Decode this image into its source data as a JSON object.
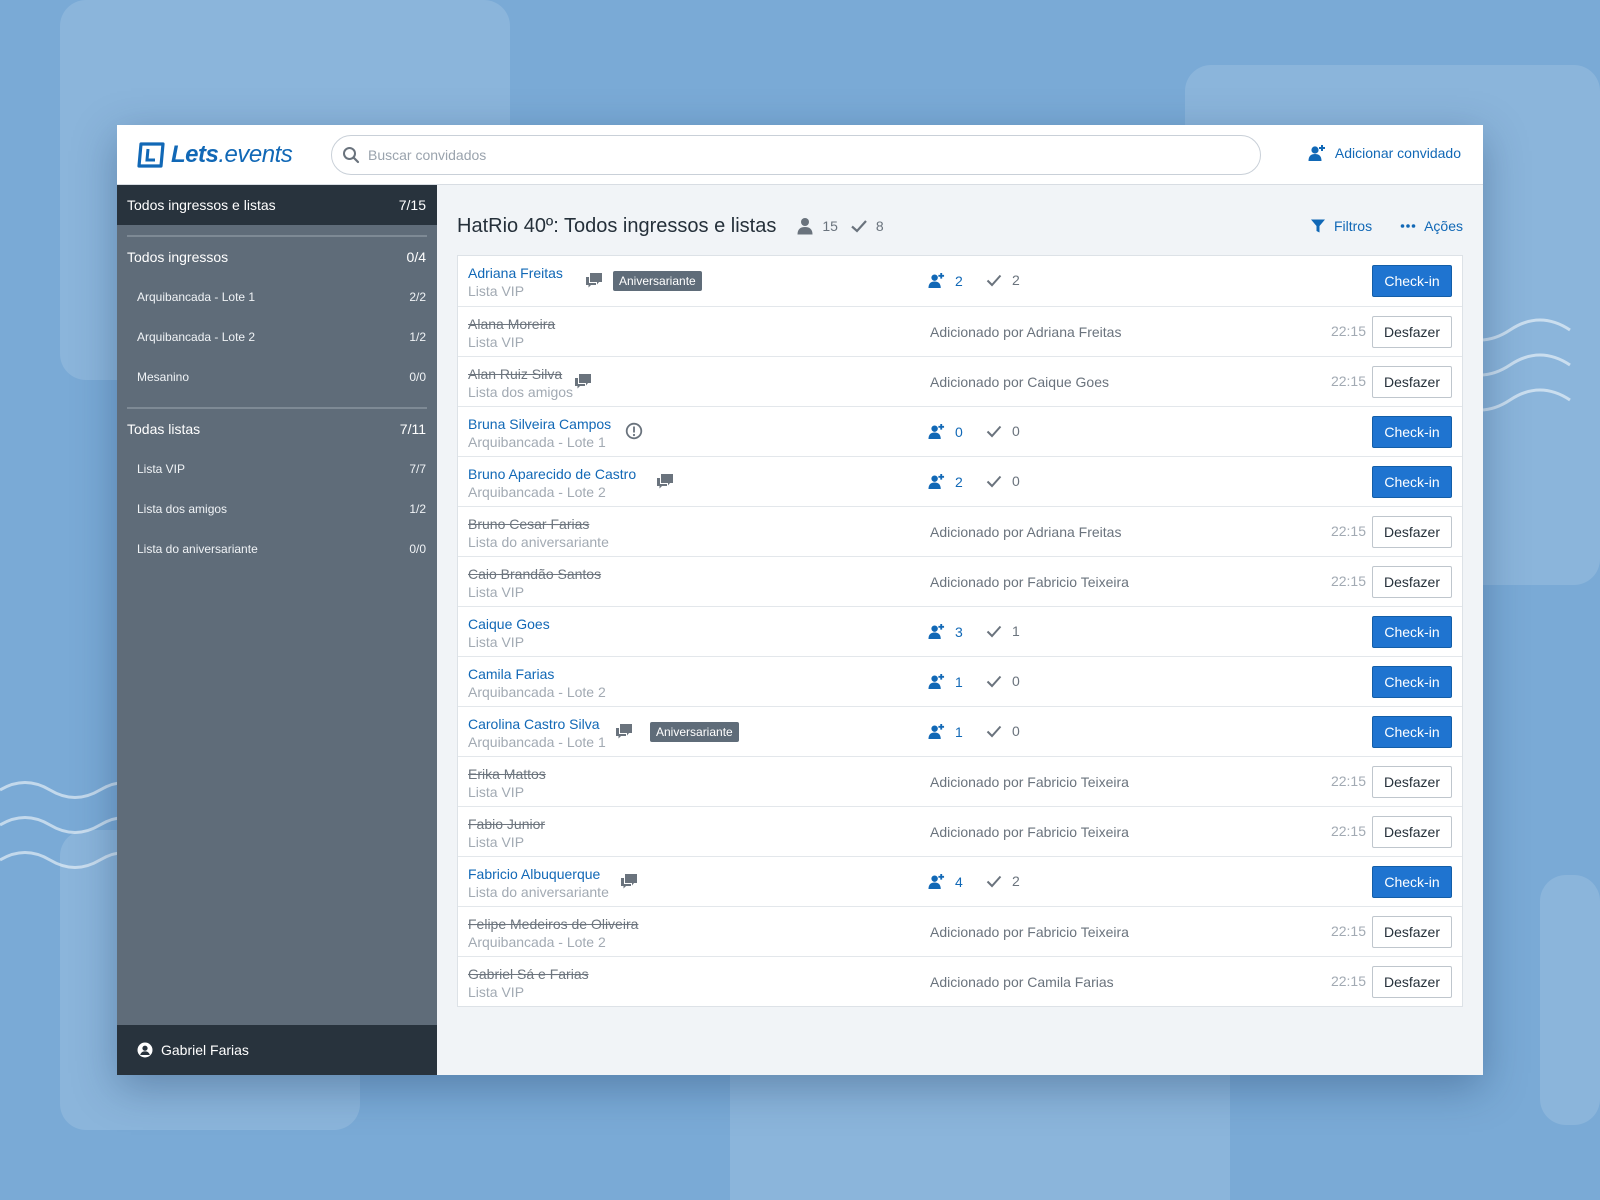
{
  "brand": {
    "name_bold": "Lets",
    "name_light": ".events"
  },
  "search": {
    "placeholder": "Buscar convidados",
    "value": ""
  },
  "header": {
    "add_guest_label": "Adicionar convidado"
  },
  "sidebar": {
    "active": {
      "label": "Todos ingressos e listas",
      "count": "7/15"
    },
    "groups": [
      {
        "label": "Todos ingressos",
        "count": "0/4",
        "items": [
          {
            "label": "Arquibancada - Lote 1",
            "count": "2/2"
          },
          {
            "label": "Arquibancada - Lote 2",
            "count": "1/2"
          },
          {
            "label": "Mesanino",
            "count": "0/0"
          }
        ]
      },
      {
        "label": "Todas listas",
        "count": "7/11",
        "items": [
          {
            "label": "Lista VIP",
            "count": "7/7"
          },
          {
            "label": "Lista dos amigos",
            "count": "1/2"
          },
          {
            "label": "Lista do aniversariante",
            "count": "0/0"
          }
        ]
      }
    ],
    "user": "Gabriel Farias"
  },
  "main": {
    "title": "HatRio 40º: Todos ingressos e listas",
    "total_guests": "15",
    "total_checked": "8",
    "filters_label": "Filtros",
    "actions_label": "Ações"
  },
  "guests": [
    {
      "name": "Adriana Freitas",
      "list": "Lista VIP",
      "status": "pending",
      "comment": true,
      "badge": "Aniversariante",
      "plus": "2",
      "checked": "2",
      "button": "Check-in"
    },
    {
      "name": "Alana Moreira",
      "list": "Lista VIP",
      "status": "done",
      "added_by": "Adicionado por Adriana Freitas",
      "time": "22:15",
      "button": "Desfazer"
    },
    {
      "name": "Alan Ruiz Silva",
      "list": "Lista dos amigos",
      "status": "done",
      "comment": true,
      "added_by": "Adicionado por Caique Goes",
      "time": "22:15",
      "button": "Desfazer"
    },
    {
      "name": "Bruna Silveira Campos",
      "list": "Arquibancada - Lote 1",
      "status": "pending",
      "alert": true,
      "plus": "0",
      "checked": "0",
      "button": "Check-in"
    },
    {
      "name": "Bruno Aparecido de Castro",
      "list": "Arquibancada - Lote 2",
      "status": "pending",
      "comment": true,
      "plus": "2",
      "checked": "0",
      "button": "Check-in"
    },
    {
      "name": "Bruno Cesar Farias",
      "list": "Lista do aniversariante",
      "status": "done",
      "added_by": "Adicionado por Adriana Freitas",
      "time": "22:15",
      "button": "Desfazer"
    },
    {
      "name": "Caio Brandão Santos",
      "list": "Lista VIP",
      "status": "done",
      "added_by": "Adicionado por Fabricio Teixeira",
      "time": "22:15",
      "button": "Desfazer"
    },
    {
      "name": "Caique Goes",
      "list": "Lista VIP",
      "status": "pending",
      "plus": "3",
      "checked": "1",
      "button": "Check-in"
    },
    {
      "name": "Camila Farias",
      "list": "Arquibancada - Lote 2",
      "status": "pending",
      "plus": "1",
      "checked": "0",
      "button": "Check-in"
    },
    {
      "name": "Carolina Castro Silva",
      "list": "Arquibancada - Lote 1",
      "status": "pending",
      "comment": true,
      "badge": "Aniversariante",
      "plus": "1",
      "checked": "0",
      "button": "Check-in"
    },
    {
      "name": "Erika Mattos",
      "list": "Lista VIP",
      "status": "done",
      "added_by": "Adicionado por Fabricio Teixeira",
      "time": "22:15",
      "button": "Desfazer"
    },
    {
      "name": "Fabio Junior",
      "list": "Lista VIP",
      "status": "done",
      "added_by": "Adicionado por Fabricio Teixeira",
      "time": "22:15",
      "button": "Desfazer"
    },
    {
      "name": "Fabricio Albuquerque",
      "list": "Lista do aniversariante",
      "status": "pending",
      "comment": true,
      "plus": "4",
      "checked": "2",
      "button": "Check-in"
    },
    {
      "name": "Felipe Medeiros de Oliveira",
      "list": "Arquibancada - Lote 2",
      "status": "done",
      "added_by": "Adicionado por Fabricio Teixeira",
      "time": "22:15",
      "button": "Desfazer"
    },
    {
      "name": "Gabriel Sá e Farias",
      "list": "Lista VIP",
      "status": "done",
      "added_by": "Adicionado por Camila Farias",
      "time": "22:15",
      "button": "Desfazer"
    }
  ],
  "colors": {
    "accent": "#1168b6",
    "button": "#1f74d0",
    "sidebar": "#5f6c79",
    "sidebar_dark": "#28333d",
    "background": "#7aaad6"
  }
}
